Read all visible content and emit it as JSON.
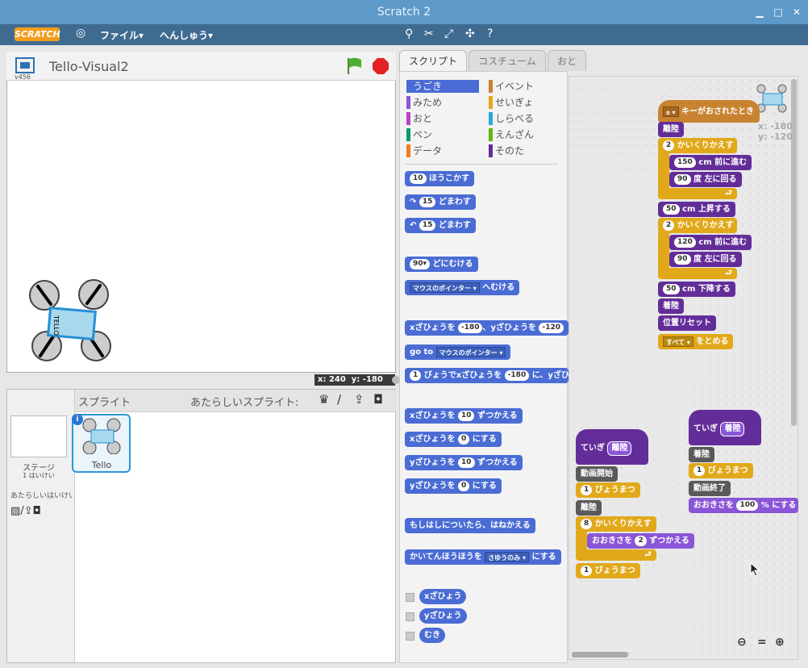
{
  "window": {
    "title": "Scratch 2"
  },
  "menu": {
    "logo": "SCRATCH",
    "file": "ファイル▾",
    "edit": "へんしゅう▾"
  },
  "stage": {
    "project": "Tello-Visual2",
    "version": "v456",
    "x_label": "x:",
    "x": "240",
    "y_label": "y:",
    "y": "-180"
  },
  "sprites": {
    "header": "スプライト",
    "new_sprite": "あたらしいスプライト:",
    "stage_label": "ステージ",
    "stage_sub": "1 はいけい",
    "new_bg": "あたらしいはいけい",
    "sprite_name": "Tello"
  },
  "tabs": [
    "スクリプト",
    "コスチューム",
    "おと"
  ],
  "categories": [
    {
      "label": "うごき",
      "color": "#4a6cd4"
    },
    {
      "label": "イベント",
      "color": "#c88330"
    },
    {
      "label": "みため",
      "color": "#8a55d7"
    },
    {
      "label": "せいぎょ",
      "color": "#e1a91a"
    },
    {
      "label": "おと",
      "color": "#bb42c3"
    },
    {
      "label": "しらべる",
      "color": "#2ca5e2"
    },
    {
      "label": "ペン",
      "color": "#0e9a6c"
    },
    {
      "label": "えんざん",
      "color": "#5cb712"
    },
    {
      "label": "データ",
      "color": "#ee7d16"
    },
    {
      "label": "そのた",
      "color": "#632d99"
    }
  ],
  "palette": {
    "move": "ほうこかす",
    "move_n": "10",
    "turn_r": "どまわす",
    "turn_n": "15",
    "turn_l": "どまわす",
    "turn_l_n": "15",
    "point": "どにむける",
    "point_n": "90▾",
    "point_to": "へむける",
    "point_to_opt": "マウスのポインター ▾",
    "goto_xy": "xざひょうを",
    "goto_x": "-180",
    "goto_mid": "、yざひょうを",
    "goto_y": "-120",
    "goto": "go to",
    "goto_opt": "マウスのポインター ▾",
    "glide_n": "1",
    "glide": "びょうでxざひょうを",
    "glide_x": "-180",
    "glide_mid": "に、yざひ",
    "change_x": "xざひょうを",
    "change_x_n": "10",
    "change_x_t": "ずつかえる",
    "set_x": "xざひょうを",
    "set_x_n": "0",
    "set_x_t": "にする",
    "change_y": "yざひょうを",
    "change_y_n": "10",
    "change_y_t": "ずつかえる",
    "set_y": "yざひょうを",
    "set_y_n": "0",
    "set_y_t": "にする",
    "bounce": "もしはしについたら、はねかえる",
    "rot": "かいてんほうほうを",
    "rot_opt": "さゆうのみ ▾",
    "rot_t": "にする",
    "rep_x": "xざひょう",
    "rep_y": "yざひょう",
    "rep_dir": "むき"
  },
  "script1": {
    "hat_key": "s ▾",
    "hat": "キーがおされたとき",
    "takeoff": "離陸",
    "rep1_n": "2",
    "rep1": "かいくりかえす",
    "fwd1_n": "150",
    "fwd1": "cm 前に進む",
    "left1_n": "90",
    "left1": "度 左に回る",
    "up_n": "50",
    "up": "cm 上昇する",
    "rep2_n": "2",
    "rep2": "かいくりかえす",
    "fwd2_n": "120",
    "fwd2": "cm 前に進む",
    "left2_n": "90",
    "left2": "度 左に回る",
    "down_n": "50",
    "down": "cm 下降する",
    "land": "着陸",
    "reset": "位置リセット",
    "stop_opt": "すべて ▾",
    "stop": "をとめる",
    "sprite_x": "x: -180",
    "sprite_y": "y: -120"
  },
  "script2": {
    "def": "ていぎ",
    "def_name": "離陸",
    "rec": "動画開始",
    "wait1_n": "1",
    "wait1": "びょうまつ",
    "takeoff": "離陸",
    "rep_n": "8",
    "rep": "かいくりかえす",
    "size": "おおきさを",
    "size_n": "2",
    "size_t": "ずつかえる",
    "wait2_n": "1",
    "wait2": "びょうまつ"
  },
  "script3": {
    "def": "ていぎ",
    "def_name": "着陸",
    "land": "着陸",
    "wait_n": "1",
    "wait": "びょうまつ",
    "rec_end": "動画終了",
    "size": "おおきさを",
    "size_n": "100",
    "size_t": "% にする"
  }
}
